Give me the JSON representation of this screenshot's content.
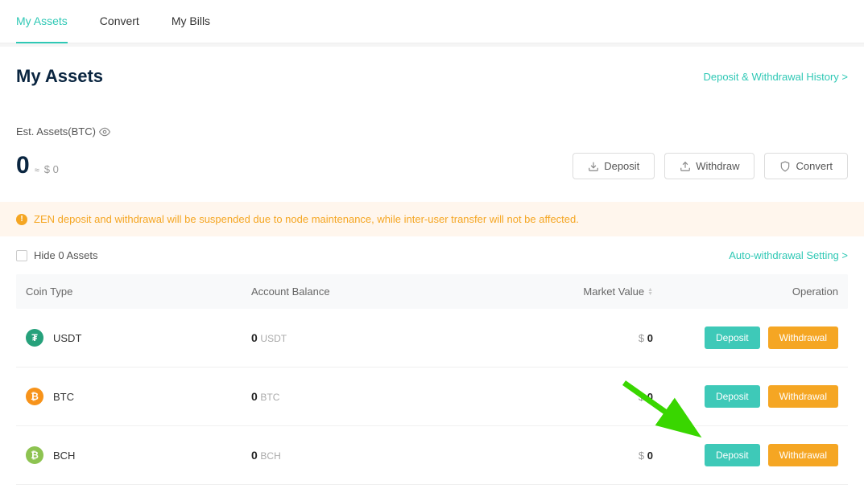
{
  "tabs": [
    {
      "label": "My Assets",
      "active": true
    },
    {
      "label": "Convert",
      "active": false
    },
    {
      "label": "My Bills",
      "active": false
    }
  ],
  "page_title": "My Assets",
  "history_link": "Deposit & Withdrawal History >",
  "est": {
    "label": "Est. Assets(BTC)",
    "value_big": "0",
    "approx": "≈",
    "value_sub": "$ 0"
  },
  "actions": {
    "deposit": "Deposit",
    "withdraw": "Withdraw",
    "convert": "Convert"
  },
  "alert": "ZEN deposit and withdrawal will be suspended due to node maintenance, while inter-user transfer will not be affected.",
  "filter": {
    "hide_label": "Hide 0 Assets",
    "auto_link": "Auto-withdrawal Setting >"
  },
  "table": {
    "headers": {
      "coin": "Coin Type",
      "balance": "Account Balance",
      "market": "Market Value",
      "operation": "Operation"
    },
    "rows": [
      {
        "symbol": "USDT",
        "icon_class": "coin-usdt",
        "icon_letter": "₮",
        "balance": "0",
        "unit": "USDT",
        "market_sym": "$",
        "market_val": "0"
      },
      {
        "symbol": "BTC",
        "icon_class": "coin-btc",
        "icon_letter": "₿",
        "balance": "0",
        "unit": "BTC",
        "market_sym": "$",
        "market_val": "0"
      },
      {
        "symbol": "BCH",
        "icon_class": "coin-bch",
        "icon_letter": "₿",
        "balance": "0",
        "unit": "BCH",
        "market_sym": "$",
        "market_val": "0"
      }
    ],
    "row_actions": {
      "deposit": "Deposit",
      "withdrawal": "Withdrawal"
    }
  },
  "colors": {
    "accent": "#2fc8b5",
    "warning": "#f5a623"
  }
}
